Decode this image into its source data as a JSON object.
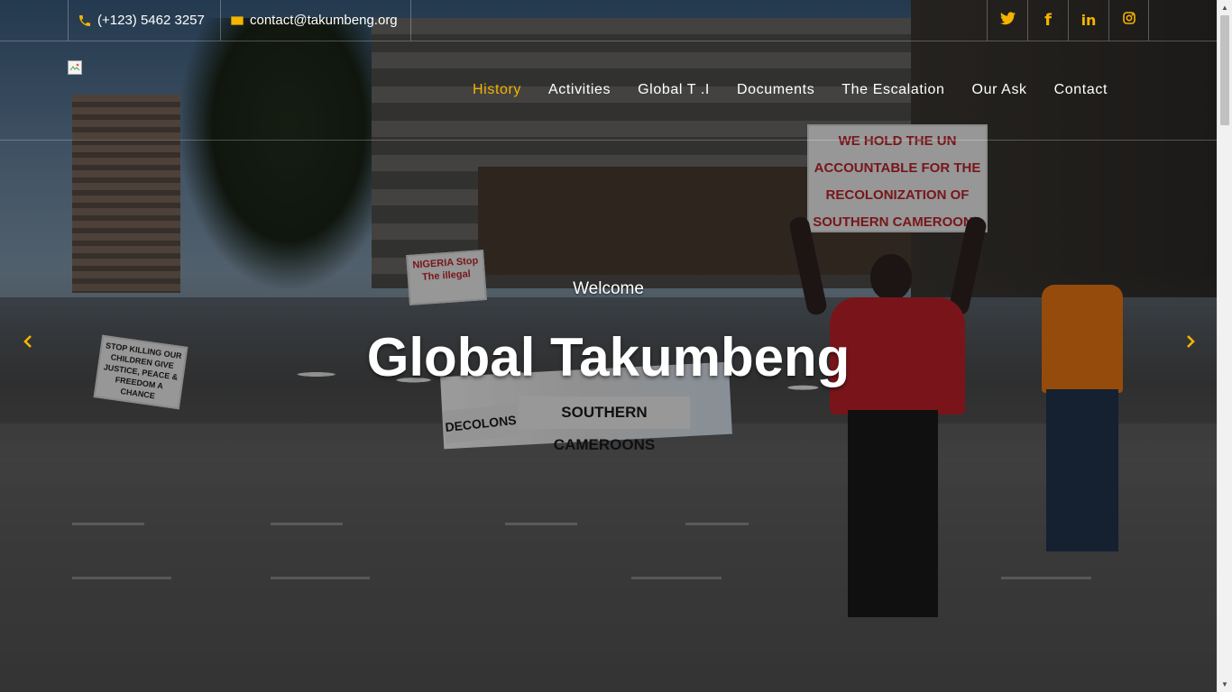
{
  "topbar": {
    "phone": "(+123) 5462 3257",
    "email": "contact@takumbeng.org",
    "social": [
      {
        "name": "twitter-icon",
        "glyph": "twitter"
      },
      {
        "name": "facebook-icon",
        "glyph": "f"
      },
      {
        "name": "linkedin-icon",
        "glyph": "in"
      },
      {
        "name": "instagram-icon",
        "glyph": "instagram"
      }
    ]
  },
  "nav": {
    "items": [
      "History",
      "Activities",
      "Global T .I",
      "Documents",
      "The Escalation",
      "Our Ask",
      "Contact"
    ],
    "active": "History"
  },
  "hero": {
    "welcome": "Welcome",
    "title": "Global Takumbeng",
    "signs": {
      "un_sign": "WE HOLD THE UN ACCOUNTABLE FOR THE RECOLONIZATION OF SOUTHERN CAMEROONS",
      "nigeria_sign": "NIGERIA Stop The illegal",
      "banner_1": "SOUTHERN CAMEROONS",
      "banner_2": "DECOLONS",
      "stop_sign": "STOP KILLING OUR CHILDREN GIVE JUSTICE, PEACE & FREEDOM A CHANCE"
    }
  },
  "colors": {
    "accent": "#f4b400",
    "text": "#ffffff"
  }
}
